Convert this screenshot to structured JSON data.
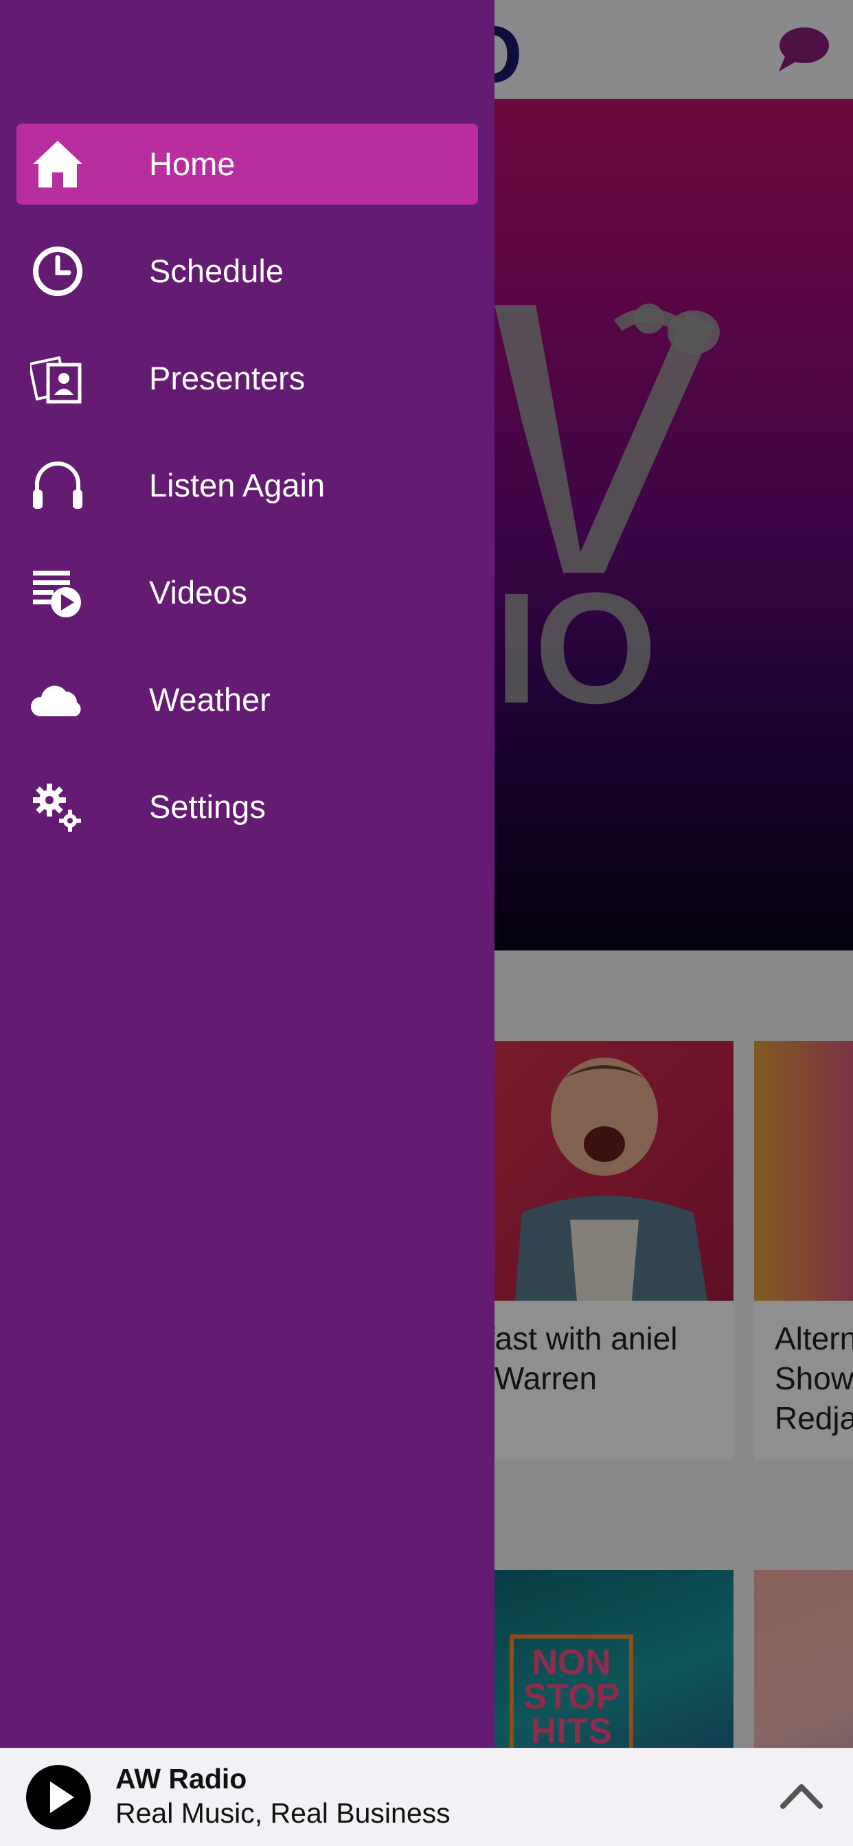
{
  "header": {
    "logo_text": "DIO",
    "chat_icon": "chat-bubble-icon"
  },
  "hero": {
    "logo_text": "IO"
  },
  "cards": [
    {
      "title": "tfast with aniel Warren"
    },
    {
      "title": "Altern Show Redja"
    }
  ],
  "cards_row2": [
    {
      "tag_text": "NON STOP HITS"
    }
  ],
  "menu": {
    "items": [
      {
        "label": "Home",
        "icon": "home-icon",
        "active": true
      },
      {
        "label": "Schedule",
        "icon": "clock-icon"
      },
      {
        "label": "Presenters",
        "icon": "presenters-icon"
      },
      {
        "label": "Listen Again",
        "icon": "headphones-icon"
      },
      {
        "label": "Videos",
        "icon": "video-playlist-icon"
      },
      {
        "label": "Weather",
        "icon": "cloud-icon"
      },
      {
        "label": "Settings",
        "icon": "gears-icon"
      }
    ]
  },
  "player": {
    "station_name": "AW Radio",
    "tagline": "Real Music, Real Business"
  },
  "colors": {
    "drawer_bg": "#641b72",
    "active_item_bg": "#b82e9f",
    "logo_navy": "#1e1a6e",
    "chat_purple": "#8a1f7a"
  }
}
